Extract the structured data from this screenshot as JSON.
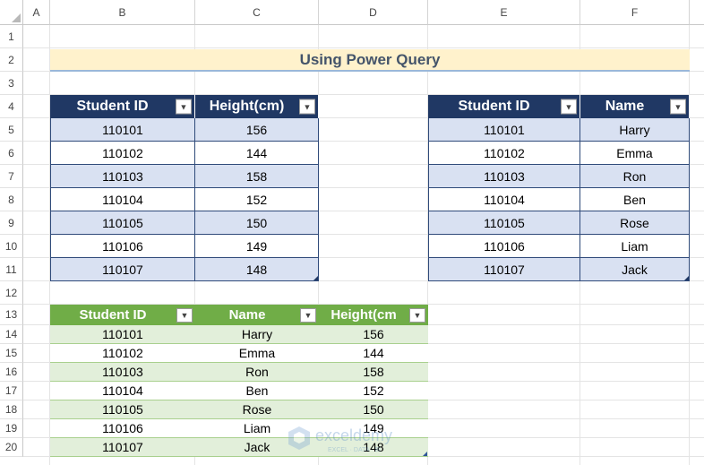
{
  "sheet": {
    "columns": [
      "A",
      "B",
      "C",
      "D",
      "E",
      "F"
    ],
    "rows": [
      "1",
      "2",
      "3",
      "4",
      "5",
      "6",
      "7",
      "8",
      "9",
      "10",
      "11",
      "12",
      "13",
      "14",
      "15",
      "16",
      "17",
      "18",
      "19",
      "20"
    ],
    "title": "Using Power Query"
  },
  "table_heights": {
    "headers": [
      "Student ID",
      "Height(cm)"
    ],
    "rows": [
      [
        "110101",
        "156"
      ],
      [
        "110102",
        "144"
      ],
      [
        "110103",
        "158"
      ],
      [
        "110104",
        "152"
      ],
      [
        "110105",
        "150"
      ],
      [
        "110106",
        "149"
      ],
      [
        "110107",
        "148"
      ]
    ]
  },
  "table_names": {
    "headers": [
      "Student ID",
      "Name"
    ],
    "rows": [
      [
        "110101",
        "Harry"
      ],
      [
        "110102",
        "Emma"
      ],
      [
        "110103",
        "Ron"
      ],
      [
        "110104",
        "Ben"
      ],
      [
        "110105",
        "Rose"
      ],
      [
        "110106",
        "Liam"
      ],
      [
        "110107",
        "Jack"
      ]
    ]
  },
  "table_merged": {
    "headers": [
      "Student ID",
      "Name",
      "Height(cm"
    ],
    "rows": [
      [
        "110101",
        "Harry",
        "156"
      ],
      [
        "110102",
        "Emma",
        "144"
      ],
      [
        "110103",
        "Ron",
        "158"
      ],
      [
        "110104",
        "Ben",
        "152"
      ],
      [
        "110105",
        "Rose",
        "150"
      ],
      [
        "110106",
        "Liam",
        "149"
      ],
      [
        "110107",
        "Jack",
        "148"
      ]
    ]
  },
  "watermark": {
    "brand": "exceldemy",
    "tagline": "EXCEL · DATA · BI"
  },
  "icons": {
    "filter": "dropdown-arrow-icon"
  },
  "colors": {
    "header_blue": "#203864",
    "band_blue": "#d9e1f2",
    "header_green": "#70ad47",
    "band_green": "#e2efda",
    "title_fill": "#fff2cc",
    "title_text": "#44546a"
  }
}
